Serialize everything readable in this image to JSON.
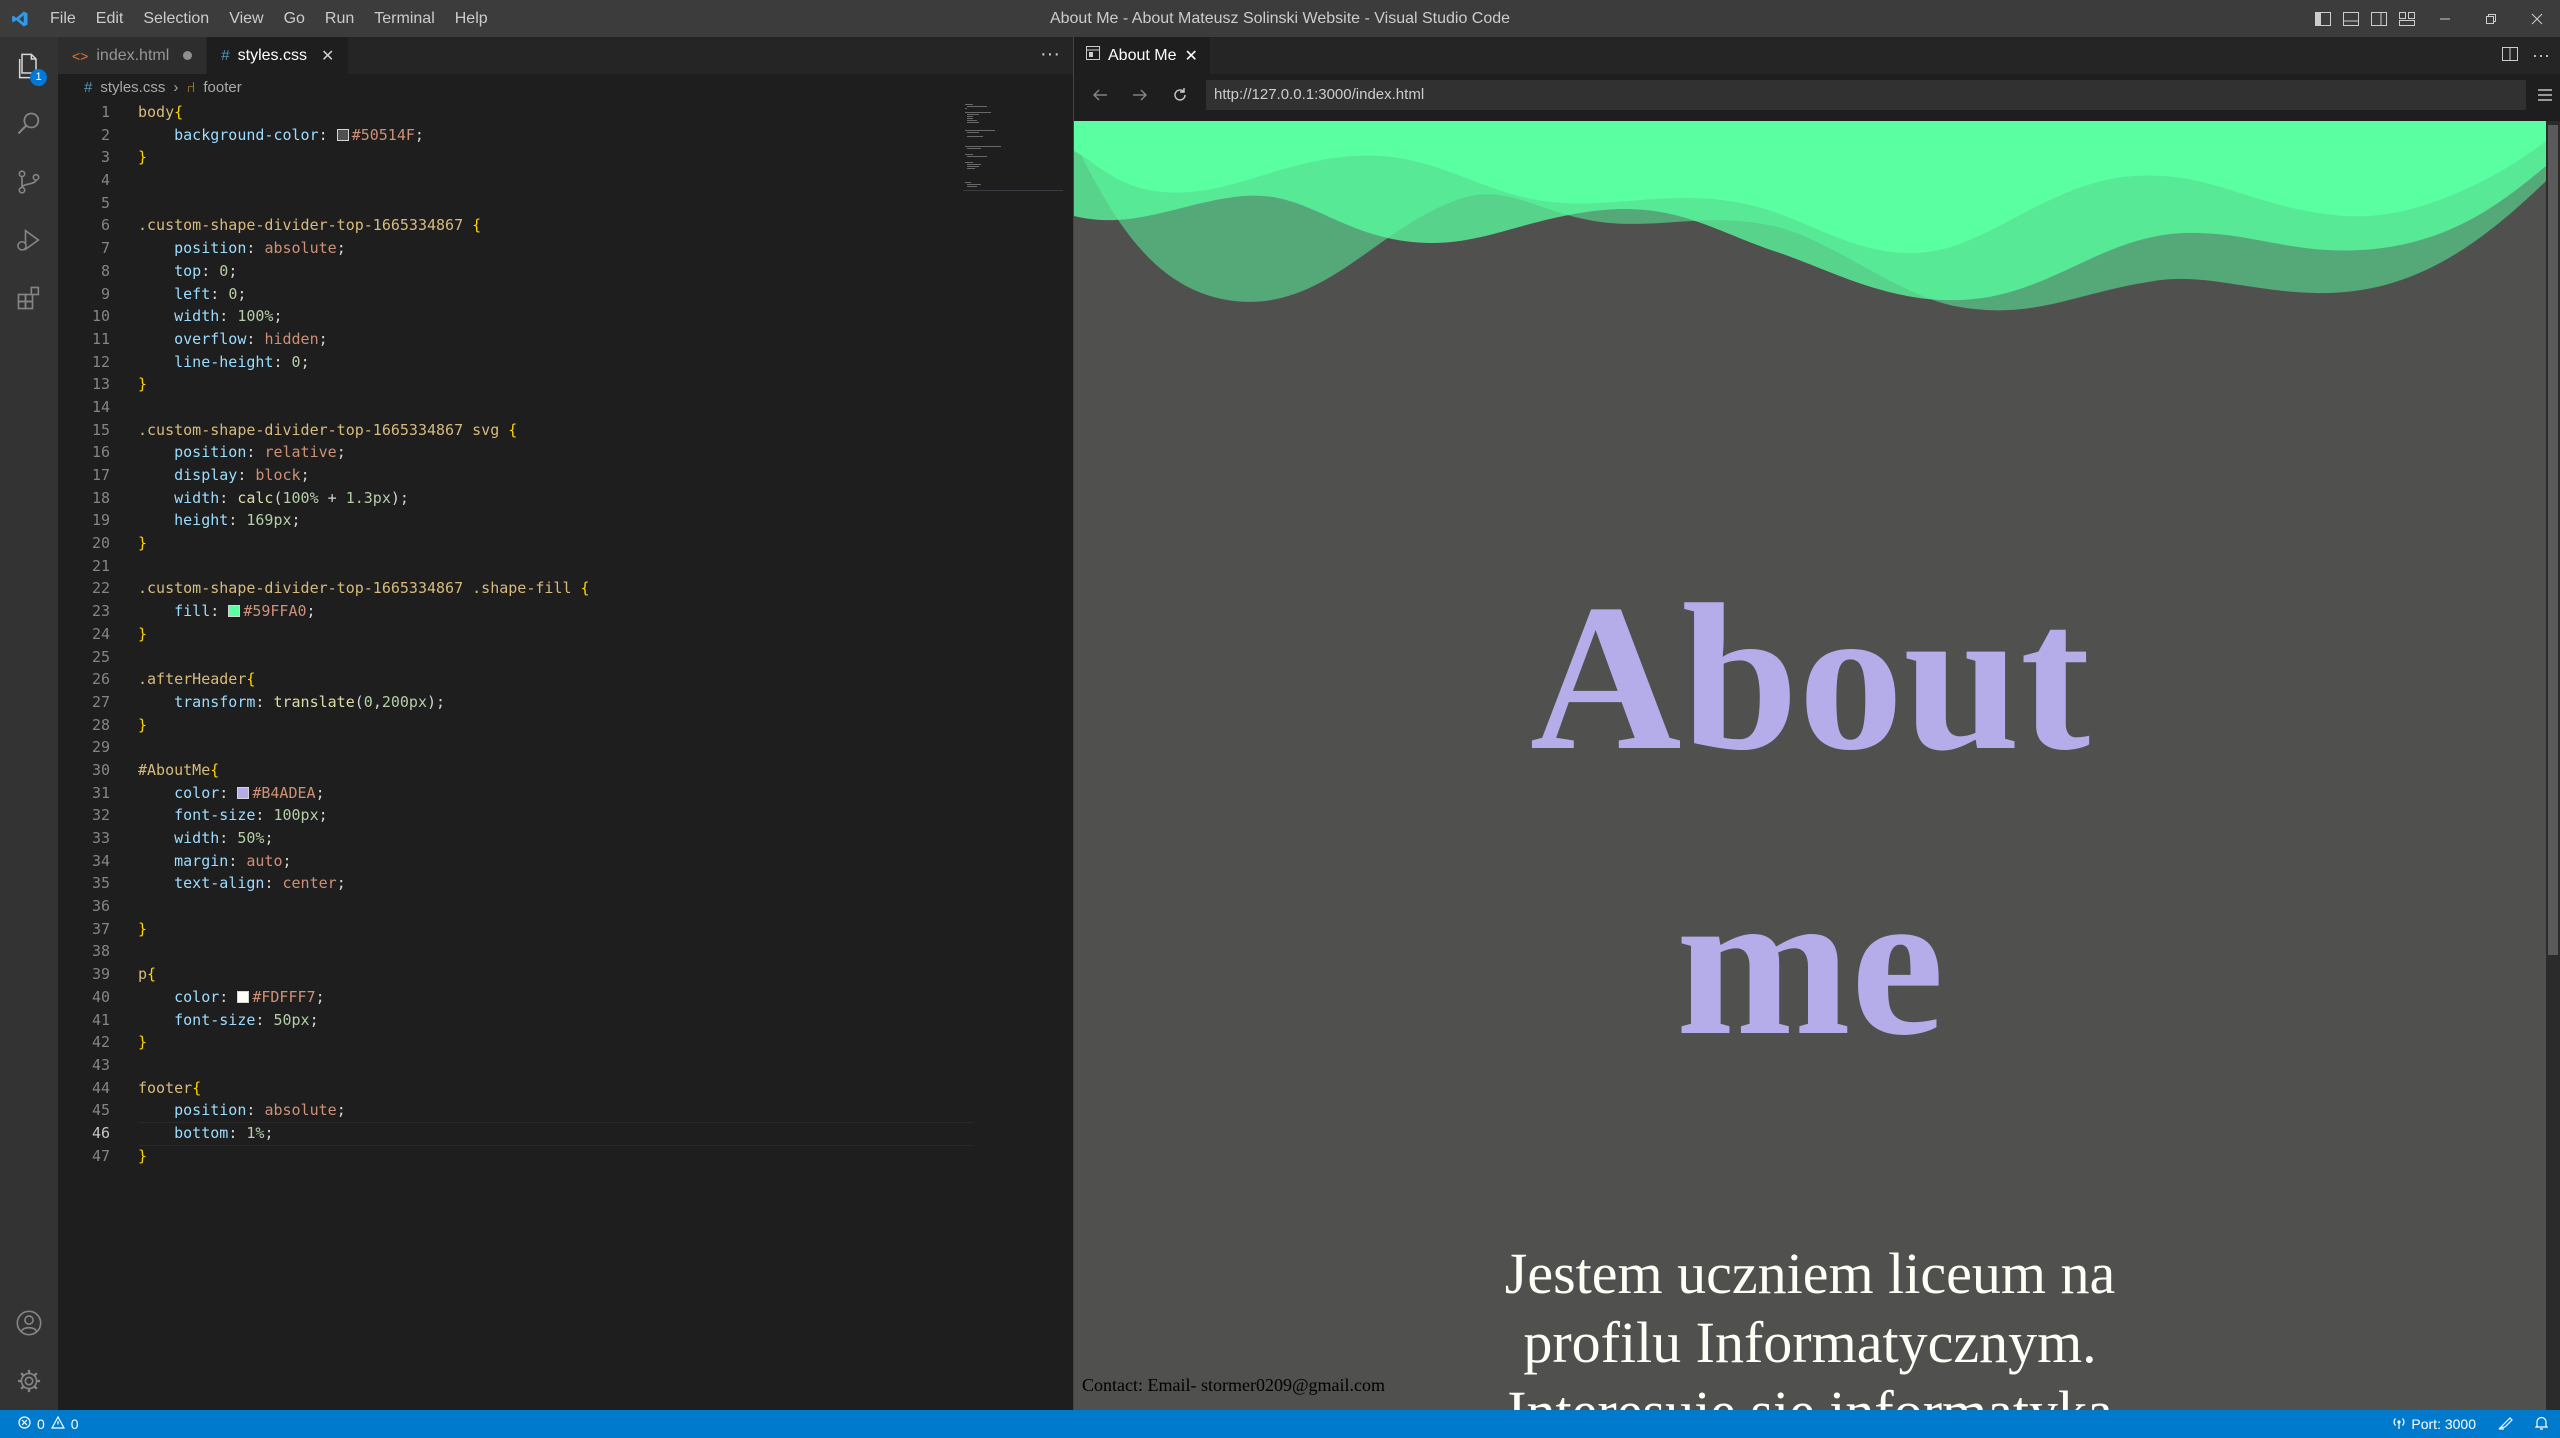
{
  "window": {
    "title": "About Me - About Mateusz Solinski Website - Visual Studio Code"
  },
  "menu": [
    "File",
    "Edit",
    "Selection",
    "View",
    "Go",
    "Run",
    "Terminal",
    "Help"
  ],
  "activity": {
    "explorer_badge": "1"
  },
  "editor": {
    "tabs": [
      {
        "label": "index.html",
        "modified": true,
        "active": false
      },
      {
        "label": "styles.css",
        "modified": false,
        "active": true
      }
    ],
    "breadcrumb": {
      "file": "styles.css",
      "symbol": "footer"
    },
    "current_line": 46,
    "lines": [
      [
        [
          "sel",
          "body"
        ],
        [
          "br",
          "{"
        ]
      ],
      [
        [
          "ind",
          "    "
        ],
        [
          "prop",
          "background-color"
        ],
        [
          "plain",
          ": "
        ],
        [
          "swatch",
          "#50514F"
        ],
        [
          "val",
          "#50514F"
        ],
        [
          "plain",
          ";"
        ]
      ],
      [
        [
          "br",
          "}"
        ]
      ],
      [],
      [],
      [
        [
          "sel",
          ".custom-shape-divider-top-1665334867"
        ],
        [
          "plain",
          " "
        ],
        [
          "br",
          "{"
        ]
      ],
      [
        [
          "ind",
          "    "
        ],
        [
          "prop",
          "position"
        ],
        [
          "plain",
          ": "
        ],
        [
          "val",
          "absolute"
        ],
        [
          "plain",
          ";"
        ]
      ],
      [
        [
          "ind",
          "    "
        ],
        [
          "prop",
          "top"
        ],
        [
          "plain",
          ": "
        ],
        [
          "num",
          "0"
        ],
        [
          "plain",
          ";"
        ]
      ],
      [
        [
          "ind",
          "    "
        ],
        [
          "prop",
          "left"
        ],
        [
          "plain",
          ": "
        ],
        [
          "num",
          "0"
        ],
        [
          "plain",
          ";"
        ]
      ],
      [
        [
          "ind",
          "    "
        ],
        [
          "prop",
          "width"
        ],
        [
          "plain",
          ": "
        ],
        [
          "num",
          "100%"
        ],
        [
          "plain",
          ";"
        ]
      ],
      [
        [
          "ind",
          "    "
        ],
        [
          "prop",
          "overflow"
        ],
        [
          "plain",
          ": "
        ],
        [
          "val",
          "hidden"
        ],
        [
          "plain",
          ";"
        ]
      ],
      [
        [
          "ind",
          "    "
        ],
        [
          "prop",
          "line-height"
        ],
        [
          "plain",
          ": "
        ],
        [
          "num",
          "0"
        ],
        [
          "plain",
          ";"
        ]
      ],
      [
        [
          "br",
          "}"
        ]
      ],
      [],
      [
        [
          "sel",
          ".custom-shape-divider-top-1665334867 svg"
        ],
        [
          "plain",
          " "
        ],
        [
          "br",
          "{"
        ]
      ],
      [
        [
          "ind",
          "    "
        ],
        [
          "prop",
          "position"
        ],
        [
          "plain",
          ": "
        ],
        [
          "val",
          "relative"
        ],
        [
          "plain",
          ";"
        ]
      ],
      [
        [
          "ind",
          "    "
        ],
        [
          "prop",
          "display"
        ],
        [
          "plain",
          ": "
        ],
        [
          "val",
          "block"
        ],
        [
          "plain",
          ";"
        ]
      ],
      [
        [
          "ind",
          "    "
        ],
        [
          "prop",
          "width"
        ],
        [
          "plain",
          ": "
        ],
        [
          "fn",
          "calc"
        ],
        [
          "plain",
          "("
        ],
        [
          "num",
          "100%"
        ],
        [
          "plain",
          " + "
        ],
        [
          "num",
          "1.3px"
        ],
        [
          "plain",
          ");"
        ]
      ],
      [
        [
          "ind",
          "    "
        ],
        [
          "prop",
          "height"
        ],
        [
          "plain",
          ": "
        ],
        [
          "num",
          "169px"
        ],
        [
          "plain",
          ";"
        ]
      ],
      [
        [
          "br",
          "}"
        ]
      ],
      [],
      [
        [
          "sel",
          ".custom-shape-divider-top-1665334867 .shape-fill"
        ],
        [
          "plain",
          " "
        ],
        [
          "br",
          "{"
        ]
      ],
      [
        [
          "ind",
          "    "
        ],
        [
          "prop",
          "fill"
        ],
        [
          "plain",
          ": "
        ],
        [
          "swatch",
          "#59FFA0"
        ],
        [
          "val",
          "#59FFA0"
        ],
        [
          "plain",
          ";"
        ]
      ],
      [
        [
          "br",
          "}"
        ]
      ],
      [],
      [
        [
          "sel",
          ".afterHeader"
        ],
        [
          "br",
          "{"
        ]
      ],
      [
        [
          "ind",
          "    "
        ],
        [
          "prop",
          "transform"
        ],
        [
          "plain",
          ": "
        ],
        [
          "fn",
          "translate"
        ],
        [
          "plain",
          "("
        ],
        [
          "num",
          "0"
        ],
        [
          "plain",
          ","
        ],
        [
          "num",
          "200px"
        ],
        [
          "plain",
          ");"
        ]
      ],
      [
        [
          "br",
          "}"
        ]
      ],
      [],
      [
        [
          "sel",
          "#AboutMe"
        ],
        [
          "br",
          "{"
        ]
      ],
      [
        [
          "ind",
          "    "
        ],
        [
          "prop",
          "color"
        ],
        [
          "plain",
          ": "
        ],
        [
          "swatch",
          "#B4ADEA"
        ],
        [
          "val",
          "#B4ADEA"
        ],
        [
          "plain",
          ";"
        ]
      ],
      [
        [
          "ind",
          "    "
        ],
        [
          "prop",
          "font-size"
        ],
        [
          "plain",
          ": "
        ],
        [
          "num",
          "100px"
        ],
        [
          "plain",
          ";"
        ]
      ],
      [
        [
          "ind",
          "    "
        ],
        [
          "prop",
          "width"
        ],
        [
          "plain",
          ": "
        ],
        [
          "num",
          "50%"
        ],
        [
          "plain",
          ";"
        ]
      ],
      [
        [
          "ind",
          "    "
        ],
        [
          "prop",
          "margin"
        ],
        [
          "plain",
          ": "
        ],
        [
          "val",
          "auto"
        ],
        [
          "plain",
          ";"
        ]
      ],
      [
        [
          "ind",
          "    "
        ],
        [
          "prop",
          "text-align"
        ],
        [
          "plain",
          ": "
        ],
        [
          "val",
          "center"
        ],
        [
          "plain",
          ";"
        ]
      ],
      [],
      [
        [
          "br",
          "}"
        ]
      ],
      [],
      [
        [
          "sel",
          "p"
        ],
        [
          "br",
          "{"
        ]
      ],
      [
        [
          "ind",
          "    "
        ],
        [
          "prop",
          "color"
        ],
        [
          "plain",
          ": "
        ],
        [
          "swatch",
          "#FDFFF7"
        ],
        [
          "val",
          "#FDFFF7"
        ],
        [
          "plain",
          ";"
        ]
      ],
      [
        [
          "ind",
          "    "
        ],
        [
          "prop",
          "font-size"
        ],
        [
          "plain",
          ": "
        ],
        [
          "num",
          "50px"
        ],
        [
          "plain",
          ";"
        ]
      ],
      [
        [
          "br",
          "}"
        ]
      ],
      [],
      [
        [
          "sel",
          "footer"
        ],
        [
          "br",
          "{"
        ]
      ],
      [
        [
          "ind",
          "    "
        ],
        [
          "prop",
          "position"
        ],
        [
          "plain",
          ": "
        ],
        [
          "val",
          "absolute"
        ],
        [
          "plain",
          ";"
        ]
      ],
      [
        [
          "ind",
          "    "
        ],
        [
          "prop",
          "bottom"
        ],
        [
          "plain",
          ": "
        ],
        [
          "num",
          "1%"
        ],
        [
          "plain",
          ";"
        ]
      ],
      [
        [
          "br",
          "}"
        ]
      ]
    ]
  },
  "browser": {
    "tab_label": "About Me",
    "url": "http://127.0.0.1:3000/index.html",
    "page": {
      "heading": "About me",
      "paragraph": "Jestem uczniem liceum na profilu Informatycznym. Interesuje sie informatyka",
      "footer": "Contact: Email- stormer0209@gmail.com"
    }
  },
  "status": {
    "errors": "0",
    "warnings": "0",
    "port": "Port: 3000"
  },
  "colors": {
    "accent": "#007acc",
    "page_bg": "#50514F",
    "wave": "#59FFA0",
    "heading": "#B4ADEA",
    "paragraph": "#FDFFF7"
  }
}
